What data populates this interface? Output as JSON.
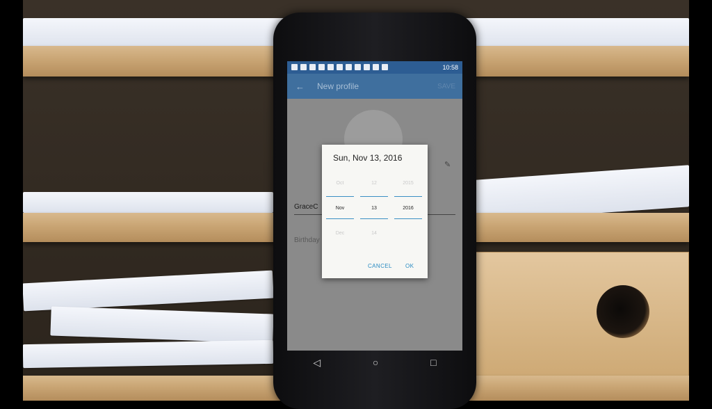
{
  "status_bar": {
    "time": "10:58"
  },
  "app_bar": {
    "title": "New profile",
    "action": "SAVE"
  },
  "form": {
    "name_value": "GraceC",
    "birthday_label": "Birthday"
  },
  "dialog": {
    "header_date": "Sun, Nov 13, 2016",
    "picker": {
      "months": [
        "Oct",
        "Nov",
        "Dec"
      ],
      "days": [
        "12",
        "13",
        "14"
      ],
      "years": [
        "2015",
        "2016",
        ""
      ],
      "selected_index": 1
    },
    "cancel_label": "CANCEL",
    "ok_label": "OK"
  },
  "nav": {
    "back": "◁",
    "home": "○",
    "recents": "□"
  },
  "icons": {
    "back": "arrow-back-icon",
    "edit": "pencil-icon"
  },
  "colors": {
    "status_bar": "#2d5d93",
    "accent": "#2a8bc2",
    "dialog_bg": "#f7f7f4"
  }
}
